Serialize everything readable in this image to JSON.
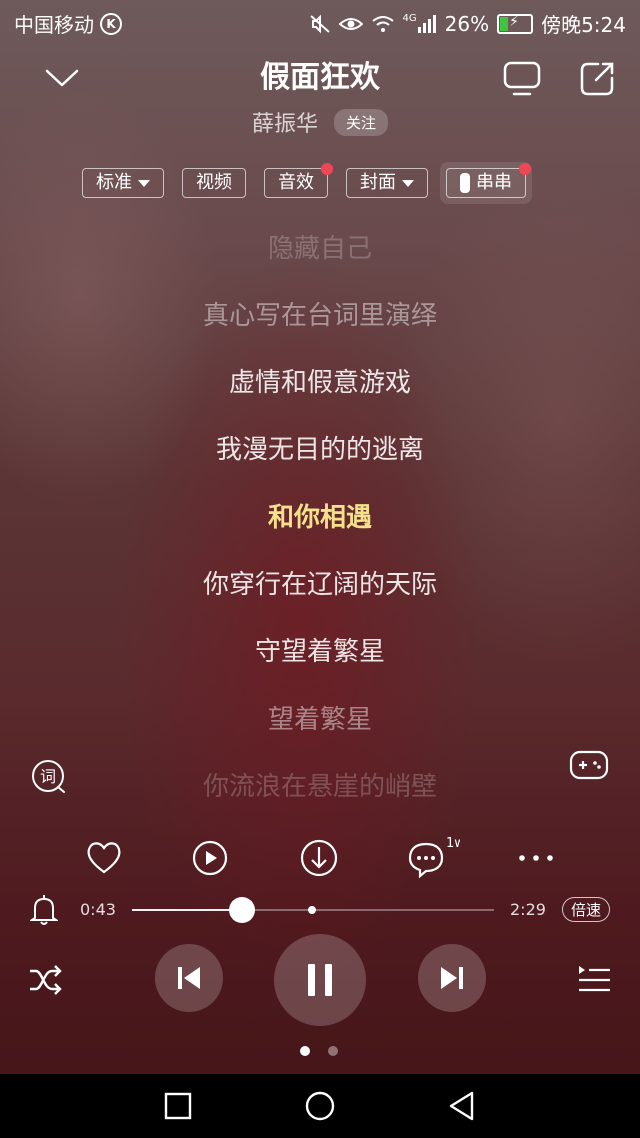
{
  "status_bar": {
    "carrier": "中国移动",
    "carrier_badge": "K",
    "network": "4G",
    "battery": "26%",
    "time": "傍晚5:24"
  },
  "header": {
    "title": "假面狂欢",
    "artist": "薛振华",
    "follow_label": "关注"
  },
  "chips": [
    {
      "label": "标准",
      "dropdown": true,
      "badge": false
    },
    {
      "label": "视频",
      "dropdown": false,
      "badge": false
    },
    {
      "label": "音效",
      "dropdown": false,
      "badge": true
    },
    {
      "label": "封面",
      "dropdown": true,
      "badge": false
    },
    {
      "label": "串串",
      "dropdown": false,
      "badge": true
    }
  ],
  "lyrics": [
    {
      "text": "隐藏自己",
      "state": "faded"
    },
    {
      "text": "真心写在台词里演绎",
      "state": "dim"
    },
    {
      "text": "虚情和假意游戏",
      "state": "normal"
    },
    {
      "text": "我漫无目的的逃离",
      "state": "normal"
    },
    {
      "text": "和你相遇",
      "state": "current"
    },
    {
      "text": "你穿行在辽阔的天际",
      "state": "normal"
    },
    {
      "text": "守望着繁星",
      "state": "normal"
    },
    {
      "text": "望着繁星",
      "state": "dim"
    },
    {
      "text": "你流浪在悬崖的峭壁",
      "state": "faded"
    }
  ],
  "lyrics_button_label": "词",
  "comment_count": "1w",
  "player": {
    "elapsed": "0:43",
    "duration": "2:29",
    "progress": 0.304,
    "buffered": 0.497,
    "speed_label": "倍速"
  },
  "pager": {
    "count": 2,
    "active": 0
  },
  "colors": {
    "current_lyric": "#f3e28b",
    "badge": "#ee4755",
    "battery_fill": "#3ec43e"
  }
}
